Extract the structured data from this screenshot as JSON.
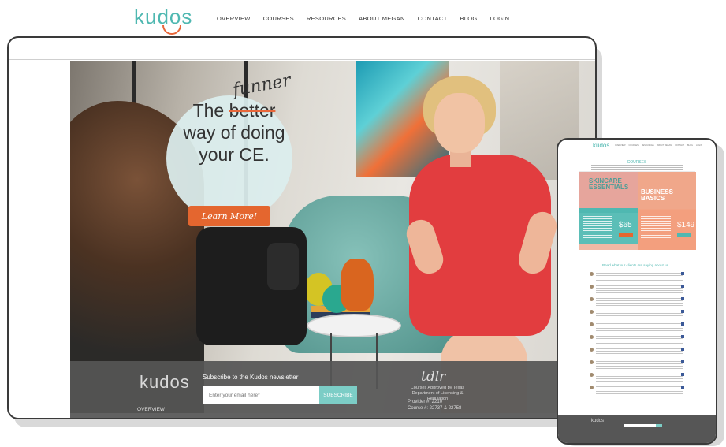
{
  "site": {
    "logo": "kudos",
    "nav": [
      "OVERVIEW",
      "COURSES",
      "RESOURCES",
      "ABOUT MEGAN",
      "CONTACT",
      "BLOG",
      "LOGIN"
    ]
  },
  "hero": {
    "line_the": "The",
    "struck_word": "better",
    "handwritten": "funner",
    "line2": "way of doing",
    "line3": "your CE.",
    "cta": "Learn More!"
  },
  "footer": {
    "logo": "kudos",
    "overview": "OVERVIEW",
    "subscribe_label": "Subscribe to the Kudos newsletter",
    "email_placeholder": "Enter your email here*",
    "subscribe_button": "SUBSCRIBE",
    "tdlr_logo": "tdlr",
    "tdlr_line1": "Courses Approved by Texas",
    "tdlr_line2": "Department of Licensing & Regulation",
    "provider": "Provider #: 2210",
    "courses": "Course #: 22737 & 22758"
  },
  "mobile": {
    "logo": "kudos",
    "nav": [
      "OVERVIEW",
      "COURSES",
      "RESOURCES",
      "ABOUT MEGAN",
      "CONTACT",
      "BLOG",
      "LOGIN"
    ],
    "section_head": "COURSES",
    "card1_title_a": "SKINCARE",
    "card1_title_b": "ESSENTIALS",
    "card1_price": "$65",
    "card2_title_a": "BUSINESS",
    "card2_title_b": "BASICS",
    "card2_price": "$149",
    "reviews_head": "Read what our clients are saying about us",
    "footer_logo": "kudos"
  },
  "colors": {
    "teal": "#4fb8b1",
    "orange": "#e4662f",
    "footer_gray": "#555555"
  }
}
